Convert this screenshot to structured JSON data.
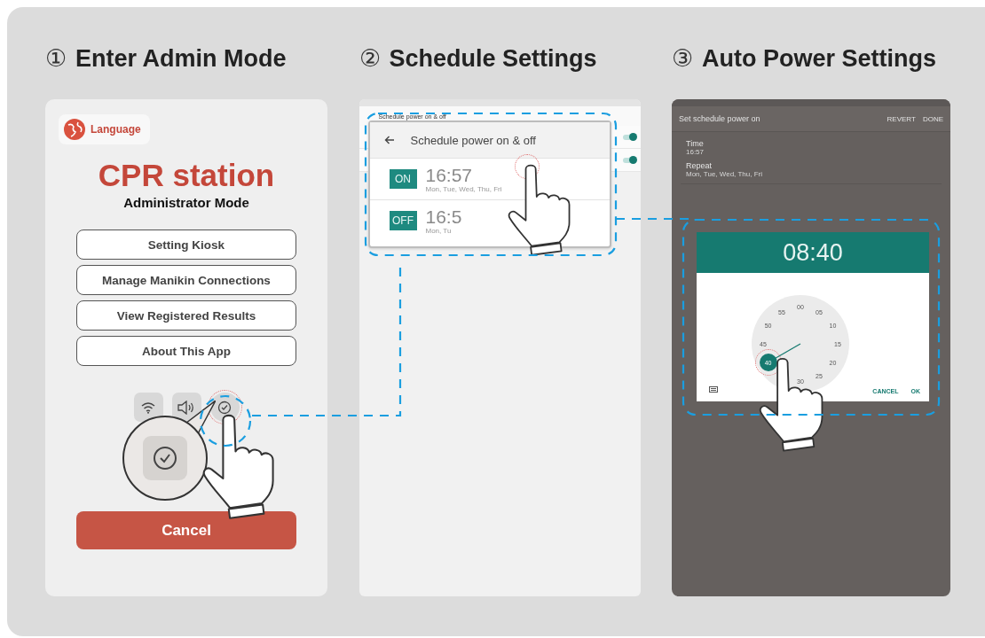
{
  "steps": [
    {
      "number": "①",
      "title": "Enter Admin Mode"
    },
    {
      "number": "②",
      "title": "Schedule Settings"
    },
    {
      "number": "③",
      "title": "Auto Power Settings"
    }
  ],
  "admin_screen": {
    "language_button": "Language",
    "app_title": "CPR station",
    "subtitle": "Administrator Mode",
    "menu_buttons": [
      "Setting Kiosk",
      "Manage Manikin Connections",
      "View Registered Results",
      "About This App"
    ],
    "quick_icons": [
      {
        "kind": "wifi",
        "highlighted": false
      },
      {
        "kind": "sound",
        "highlighted": false
      },
      {
        "kind": "timer",
        "highlighted": true
      }
    ],
    "cancel_button": "Cancel"
  },
  "schedule_screen": {
    "header": "Schedule power on & off",
    "switches": [
      {
        "on": true
      },
      {
        "on": true
      }
    ],
    "card": {
      "title": "Schedule power on & off",
      "entries": [
        {
          "tag": "ON",
          "time": "16:57",
          "days": "Mon, Tue, Wed, Thu, Fri"
        },
        {
          "tag": "OFF",
          "time": "16:5",
          "days": "Mon, Tu"
        }
      ]
    }
  },
  "power_screen": {
    "title": "Set schedule power on",
    "actions": [
      "REVERT",
      "DONE"
    ],
    "fields": [
      {
        "label": "Time",
        "value": "16:57"
      },
      {
        "label": "Repeat",
        "value": "Mon, Tue, Wed, Thu, Fri"
      }
    ],
    "dialog": {
      "time": "08:40",
      "clock_numbers": [
        {
          "label": "00",
          "selected": false
        },
        {
          "label": "05",
          "selected": false
        },
        {
          "label": "10",
          "selected": false
        },
        {
          "label": "15",
          "selected": false
        },
        {
          "label": "20",
          "selected": false
        },
        {
          "label": "25",
          "selected": false
        },
        {
          "label": "30",
          "selected": false
        },
        {
          "label": "40",
          "selected": true
        },
        {
          "label": "45",
          "selected": false
        },
        {
          "label": "50",
          "selected": false
        },
        {
          "label": "55",
          "selected": false
        }
      ],
      "buttons": [
        "CANCEL",
        "OK"
      ]
    }
  }
}
